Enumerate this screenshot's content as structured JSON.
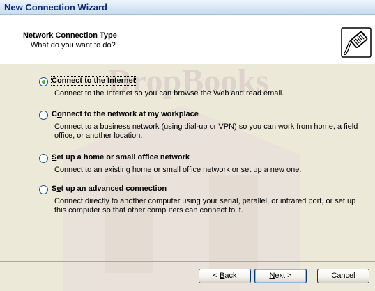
{
  "window": {
    "title": "New Connection Wizard"
  },
  "header": {
    "title": "Network Connection Type",
    "subtitle": "What do you want to do?",
    "icon": "network-cable-icon"
  },
  "options": [
    {
      "label_pre": "",
      "label_key": "C",
      "label_post": "onnect to the Internet",
      "description": "Connect to the Internet so you can browse the Web and read email.",
      "checked": true
    },
    {
      "label_pre": "C",
      "label_key": "o",
      "label_post": "nnect to the network at my workplace",
      "description": "Connect to a business network (using dial-up or VPN) so you can work from home, a field office, or another location.",
      "checked": false
    },
    {
      "label_pre": "",
      "label_key": "S",
      "label_post": "et up a home or small office network",
      "description": "Connect to an existing home or small office network or set up a new one.",
      "checked": false
    },
    {
      "label_pre": "S",
      "label_key": "e",
      "label_post": "t up an advanced connection",
      "description": "Connect directly to another computer using your serial, parallel, or infrared port, or set up this computer so that other computers can connect to it.",
      "checked": false
    }
  ],
  "buttons": {
    "back_pre": "< ",
    "back_key": "B",
    "back_post": "ack",
    "next_key": "N",
    "next_post": "ext >",
    "cancel": "Cancel"
  },
  "watermark": {
    "text": "DropBooks",
    "color": "#d9c9c9"
  }
}
